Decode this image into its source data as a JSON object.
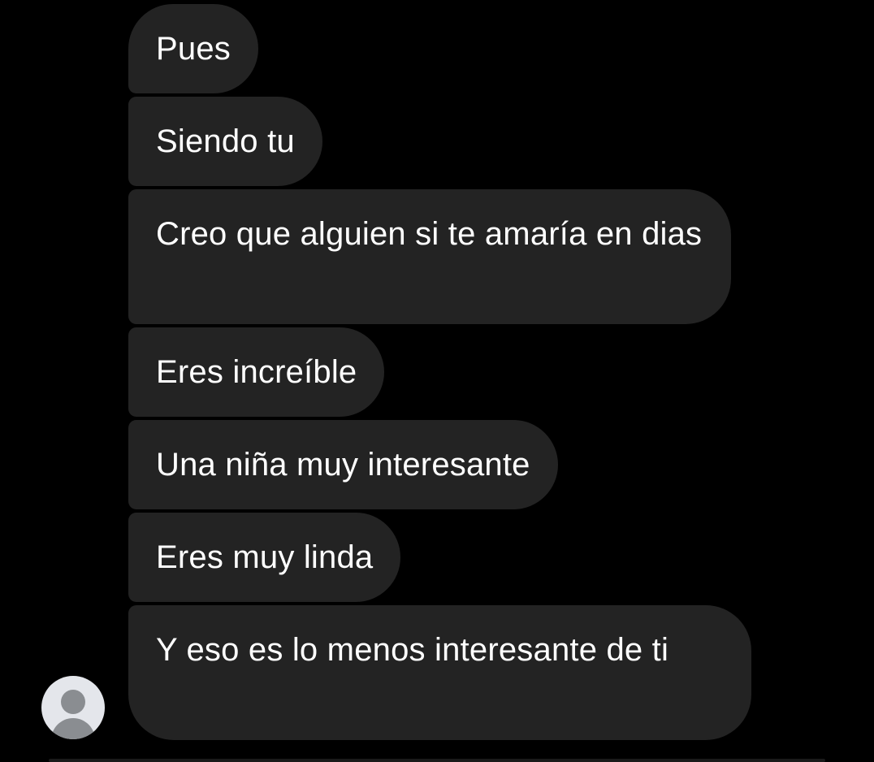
{
  "messages": [
    {
      "text": "Pues"
    },
    {
      "text": "Siendo tu"
    },
    {
      "text": "Creo que alguien si te amaría en dias"
    },
    {
      "text": "Eres increíble"
    },
    {
      "text": "Una niña muy interesante"
    },
    {
      "text": "Eres muy linda"
    },
    {
      "text": "Y eso es lo menos interesante de ti"
    }
  ],
  "colors": {
    "background": "#000000",
    "bubble": "#232323",
    "text": "#ffffff",
    "avatar_bg": "#e4e6eb",
    "avatar_fg": "#8a8d91"
  },
  "avatar": {
    "icon": "default-person-icon"
  }
}
